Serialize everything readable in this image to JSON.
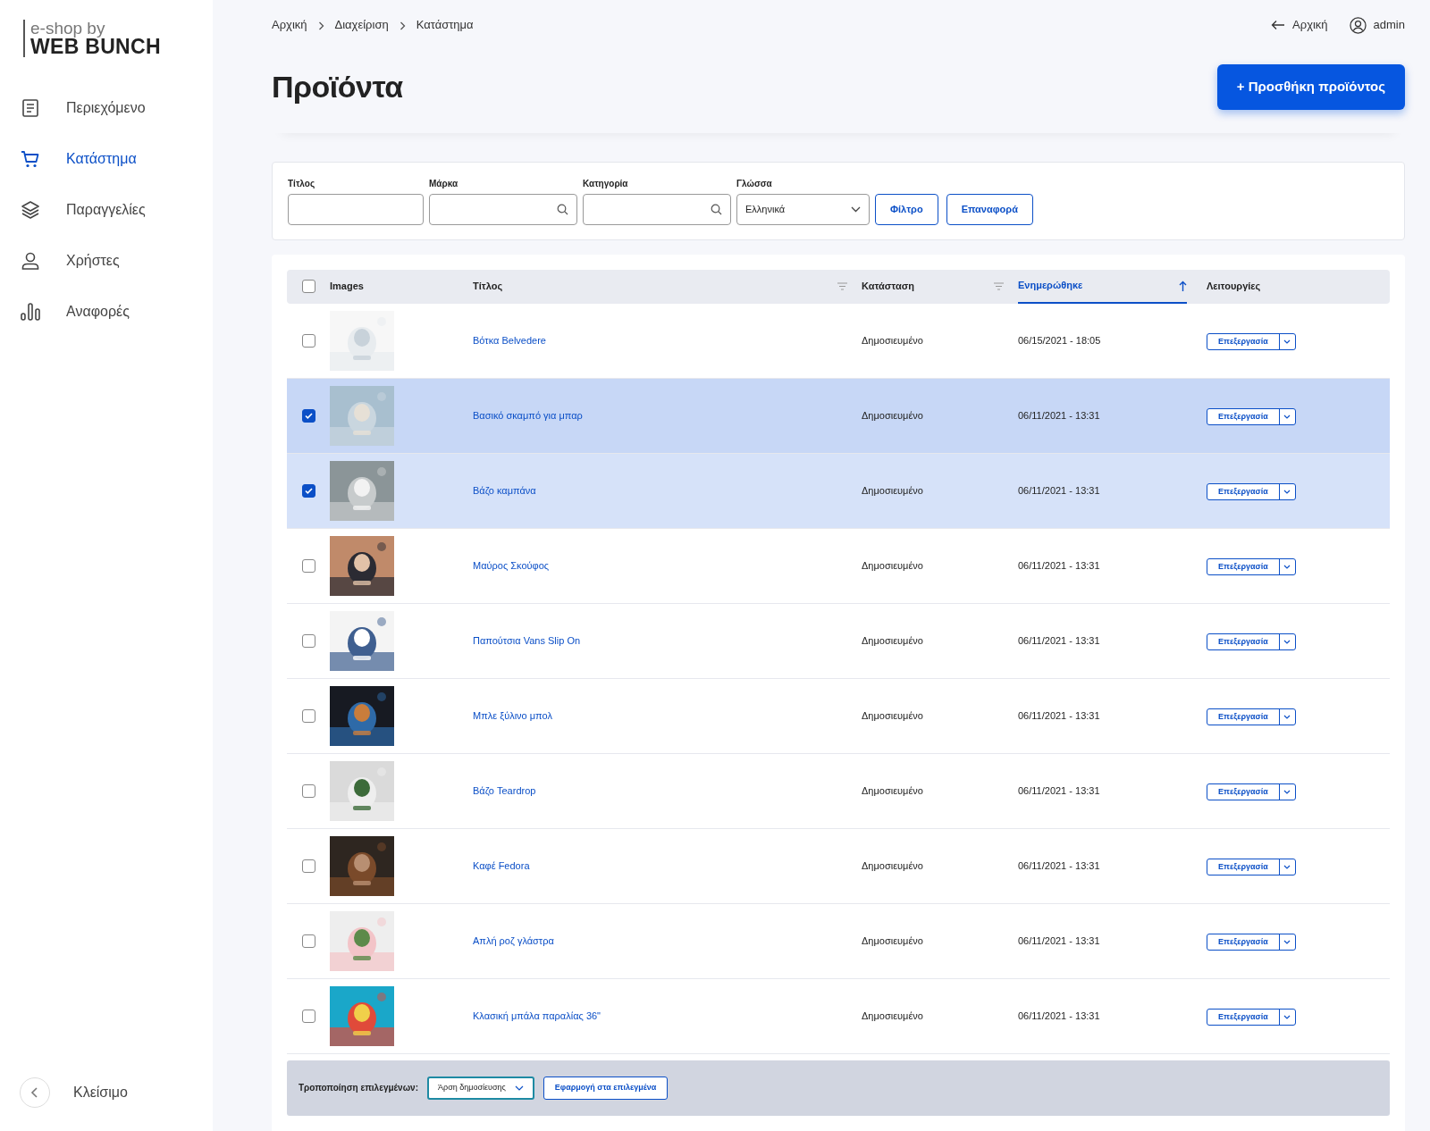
{
  "sidebar": {
    "logo": {
      "top": "e-shop by",
      "bottom": "WEB BUNCH"
    },
    "items": [
      {
        "label": "Περιεχόμενο",
        "selected": false
      },
      {
        "label": "Κατάστημα",
        "selected": true
      },
      {
        "label": "Παραγγελίες",
        "selected": false
      },
      {
        "label": "Χρήστες",
        "selected": false
      },
      {
        "label": "Αναφορές",
        "selected": false
      }
    ],
    "collapse": {
      "label": "Κλείσιμο"
    }
  },
  "breadcrumb": [
    "Αρχική",
    "Διαχείριση",
    "Κατάστημα"
  ],
  "top_links": {
    "home": "Αρχική",
    "user": "admin"
  },
  "page_title": "Προϊόντα",
  "add_button": "+ Προσθήκη προϊόντος",
  "filters": {
    "fields": [
      {
        "label": "Τίτλος",
        "kind": "text"
      },
      {
        "label": "Μάρκα",
        "kind": "search"
      },
      {
        "label": "Κατηγορία",
        "kind": "search"
      },
      {
        "label": "Γλώσσα",
        "kind": "select",
        "value": "Ελληνικά"
      }
    ],
    "buttons": [
      "Φίλτρο",
      "Επαναφορά"
    ]
  },
  "table": {
    "select_all": {
      "checked": false
    },
    "columns": [
      {
        "label": "Images"
      },
      {
        "label": "Τίτλος",
        "sorted": false
      },
      {
        "label": "Κατάσταση",
        "sorted": false
      },
      {
        "label": "Ενημερώθηκε",
        "sorted": true
      },
      {
        "label": "Λειτουργίες"
      }
    ],
    "rows": [
      {
        "checked": false,
        "title": "Βότκα Belvedere",
        "status": "Δημοσιευμένο",
        "updated": "06/15/2021 - 18:05",
        "action": "Επεξεργασία"
      },
      {
        "checked": true,
        "title": "Βασικό σκαμπό για μπαρ",
        "status": "Δημοσιευμένο",
        "updated": "06/11/2021 - 13:31",
        "action": "Επεξεργασία"
      },
      {
        "checked": true,
        "title": "Βάζο καμπάνα",
        "status": "Δημοσιευμένο",
        "updated": "06/11/2021 - 13:31",
        "action": "Επεξεργασία"
      },
      {
        "checked": false,
        "title": "Μαύρος Σκούφος",
        "status": "Δημοσιευμένο",
        "updated": "06/11/2021 - 13:31",
        "action": "Επεξεργασία"
      },
      {
        "checked": false,
        "title": "Παπούτσια Vans Slip On",
        "status": "Δημοσιευμένο",
        "updated": "06/11/2021 - 13:31",
        "action": "Επεξεργασία"
      },
      {
        "checked": false,
        "title": "Μπλε ξύλινο μπολ",
        "status": "Δημοσιευμένο",
        "updated": "06/11/2021 - 13:31",
        "action": "Επεξεργασία"
      },
      {
        "checked": false,
        "title": "Βάζο Teardrop",
        "status": "Δημοσιευμένο",
        "updated": "06/11/2021 - 13:31",
        "action": "Επεξεργασία"
      },
      {
        "checked": false,
        "title": "Καφέ Fedora",
        "status": "Δημοσιευμένο",
        "updated": "06/11/2021 - 13:31",
        "action": "Επεξεργασία"
      },
      {
        "checked": false,
        "title": "Απλή ροζ γλάστρα",
        "status": "Δημοσιευμένο",
        "updated": "06/11/2021 - 13:31",
        "action": "Επεξεργασία"
      },
      {
        "checked": false,
        "title": "Κλασική μπάλα παραλίας 36\"",
        "status": "Δημοσιευμένο",
        "updated": "06/11/2021 - 13:31",
        "action": "Επεξεργασία"
      }
    ]
  },
  "bulk_bar": {
    "label": "Τροποποίηση επιλεγμένων:",
    "select_value": "Άρση δημοσίευσης",
    "apply": "Εφαρμογή στα επιλεγμένα"
  }
}
